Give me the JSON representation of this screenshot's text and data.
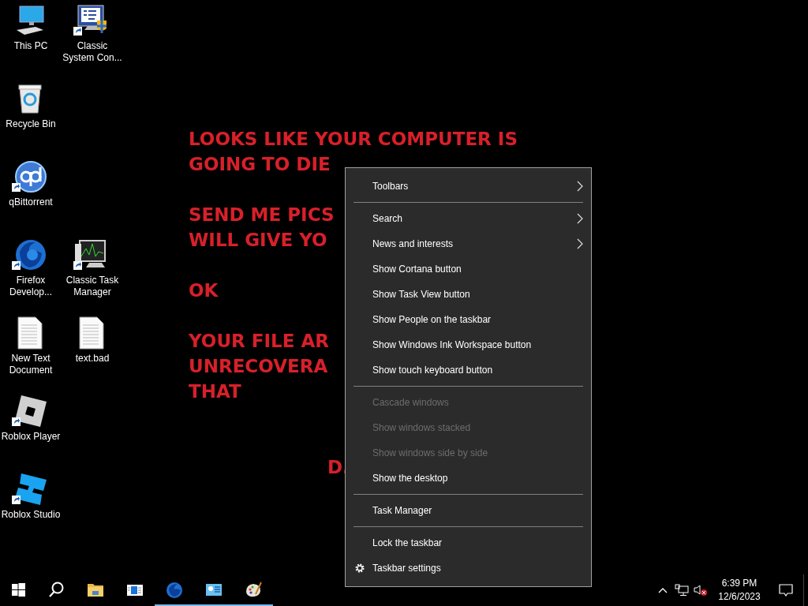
{
  "desktop_icons": [
    [
      {
        "label": "This PC",
        "kind": "computer",
        "shortcut": false
      },
      {
        "label": "Classic System Con...",
        "kind": "control-panel",
        "shortcut": true
      }
    ],
    [
      {
        "label": "Recycle Bin",
        "kind": "recycle-bin",
        "shortcut": false
      }
    ],
    [
      {
        "label": "qBittorrent",
        "kind": "qbittorrent",
        "shortcut": true
      }
    ],
    [
      {
        "label": "Firefox Develop...",
        "kind": "firefox",
        "shortcut": true
      },
      {
        "label": "Classic Task Manager",
        "kind": "task-manager",
        "shortcut": true
      }
    ],
    [
      {
        "label": "New Text Document",
        "kind": "text-file",
        "shortcut": false
      },
      {
        "label": "text.bad",
        "kind": "text-file",
        "shortcut": false
      }
    ],
    [
      {
        "label": "Roblox Player",
        "kind": "roblox-player",
        "shortcut": true
      }
    ],
    [
      {
        "label": "Roblox Studio",
        "kind": "roblox-studio",
        "shortcut": true
      }
    ]
  ],
  "wallpaper_message": {
    "paragraphs": [
      [
        "LOOKS LIKE YOUR COMPUTER IS",
        "GOING TO DIE"
      ],
      [
        "SEND ME PICS",
        "WILL GIVE YO"
      ],
      [
        "OK"
      ],
      [
        "YOUR FILE AR",
        "UNRECOVERA",
        "THAT"
      ]
    ],
    "signature": "D."
  },
  "context_menu": [
    {
      "kind": "item",
      "label": "Toolbars",
      "submenu": true,
      "disabled": false
    },
    {
      "kind": "separator"
    },
    {
      "kind": "item",
      "label": "Search",
      "submenu": true,
      "disabled": false
    },
    {
      "kind": "item",
      "label": "News and interests",
      "submenu": true,
      "disabled": false
    },
    {
      "kind": "item",
      "label": "Show Cortana button",
      "submenu": false,
      "disabled": false
    },
    {
      "kind": "item",
      "label": "Show Task View button",
      "submenu": false,
      "disabled": false
    },
    {
      "kind": "item",
      "label": "Show People on the taskbar",
      "submenu": false,
      "disabled": false
    },
    {
      "kind": "item",
      "label": "Show Windows Ink Workspace button",
      "submenu": false,
      "disabled": false
    },
    {
      "kind": "item",
      "label": "Show touch keyboard button",
      "submenu": false,
      "disabled": false
    },
    {
      "kind": "separator"
    },
    {
      "kind": "item",
      "label": "Cascade windows",
      "submenu": false,
      "disabled": true
    },
    {
      "kind": "item",
      "label": "Show windows stacked",
      "submenu": false,
      "disabled": true
    },
    {
      "kind": "item",
      "label": "Show windows side by side",
      "submenu": false,
      "disabled": true
    },
    {
      "kind": "item",
      "label": "Show the desktop",
      "submenu": false,
      "disabled": false
    },
    {
      "kind": "separator"
    },
    {
      "kind": "item",
      "label": "Task Manager",
      "submenu": false,
      "disabled": false
    },
    {
      "kind": "separator"
    },
    {
      "kind": "item",
      "label": "Lock the taskbar",
      "submenu": false,
      "disabled": false
    },
    {
      "kind": "settings",
      "label": "Taskbar settings",
      "submenu": false,
      "disabled": false
    }
  ],
  "taskbar": {
    "buttons": [
      {
        "kind": "start",
        "running": false
      },
      {
        "kind": "search",
        "running": false
      },
      {
        "kind": "folder",
        "running": false
      },
      {
        "kind": "window-app",
        "running": false
      },
      {
        "kind": "firefox",
        "running": true
      },
      {
        "kind": "control-panel",
        "running": true
      },
      {
        "kind": "paint",
        "running": true
      }
    ],
    "clock": {
      "time": "6:39 PM",
      "date": "12/6/2023"
    }
  }
}
